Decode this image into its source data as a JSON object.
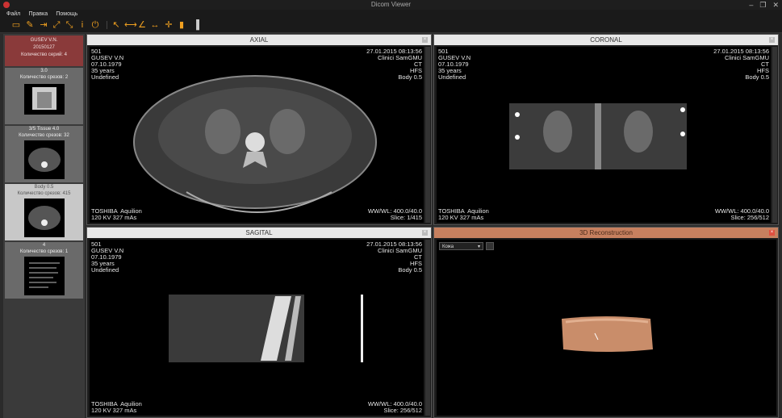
{
  "window": {
    "title": "Dicom Viewer"
  },
  "menu": [
    "Файл",
    "Правка",
    "Помощь"
  ],
  "patient": {
    "name": "GUSEV V.N.",
    "date": "20150127",
    "series_count": "Количество серий: 4"
  },
  "series": [
    {
      "title": "3.0",
      "slices": "Количество срезов: 2"
    },
    {
      "title": "3/5 Tissue 4.0",
      "slices": "Количество срезов: 32"
    },
    {
      "title": "Body 0.5",
      "slices": "Количество срезов: 415"
    },
    {
      "title": "4",
      "slices": "Количество срезов: 1"
    }
  ],
  "overlay": {
    "id": "501",
    "patient": "GUSEV V.N",
    "birth": "07.10.1979",
    "age": "35 years",
    "sex": "Undefined",
    "datetime": "27.01.2015 08:13:56",
    "institution": "Clinici SamGMU",
    "modality": "CT",
    "position": "HFS",
    "protocol": "Body 0.5",
    "device": "TOSHIBA  Aquilion",
    "exposure": "120 KV 327 mAs",
    "wwwl": "WW/WL: 400.0/40.0"
  },
  "panels": {
    "axial": {
      "title": "AXIAL",
      "slice": "Slice: 1/415"
    },
    "coronal": {
      "title": "CORONAL",
      "slice": "Slice: 256/512"
    },
    "sagital": {
      "title": "SAGITAL",
      "slice": "Slice: 256/512"
    },
    "recon": {
      "title": "3D Reconstruction",
      "preset": "Кожа"
    }
  }
}
